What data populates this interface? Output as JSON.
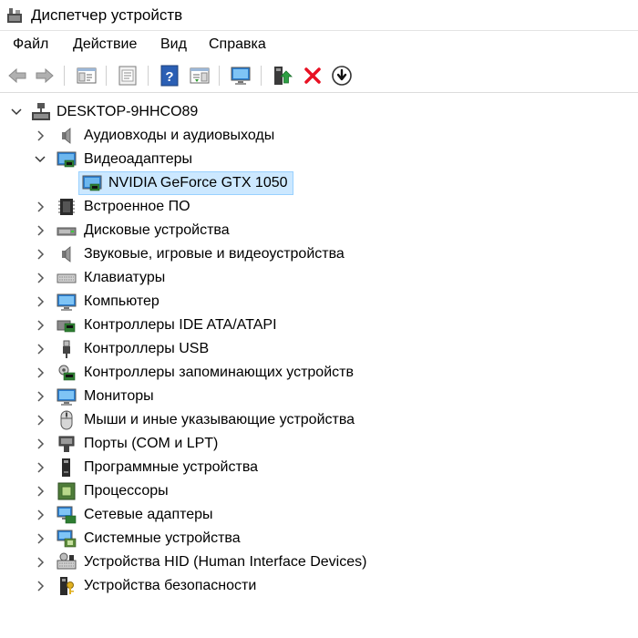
{
  "window": {
    "title": "Диспетчер устройств"
  },
  "menu": {
    "file": "Файл",
    "action": "Действие",
    "view": "Вид",
    "help": "Справка"
  },
  "tree": {
    "root": "DESKTOP-9HHCO89",
    "categories": {
      "audio_io": "Аудиовходы и аудиовыходы",
      "video_adapters": "Видеоадаптеры",
      "gpu": "NVIDIA GeForce GTX 1050",
      "firmware": "Встроенное ПО",
      "disk_drives": "Дисковые устройства",
      "sound_devices": "Звуковые, игровые и видеоустройства",
      "keyboards": "Клавиатуры",
      "computer": "Компьютер",
      "ide": "Контроллеры IDE ATA/ATAPI",
      "usb": "Контроллеры USB",
      "storage": "Контроллеры запоминающих устройств",
      "monitors": "Мониторы",
      "mice": "Мыши и иные указывающие устройства",
      "ports": "Порты (COM и LPT)",
      "software_devices": "Программные устройства",
      "processors": "Процессоры",
      "network": "Сетевые адаптеры",
      "system": "Системные устройства",
      "hid": "Устройства HID (Human Interface Devices)",
      "security": "Устройства безопасности"
    }
  },
  "colors": {
    "selection": "#cce8ff",
    "accent": "#0078d7",
    "remove": "#e81123"
  }
}
